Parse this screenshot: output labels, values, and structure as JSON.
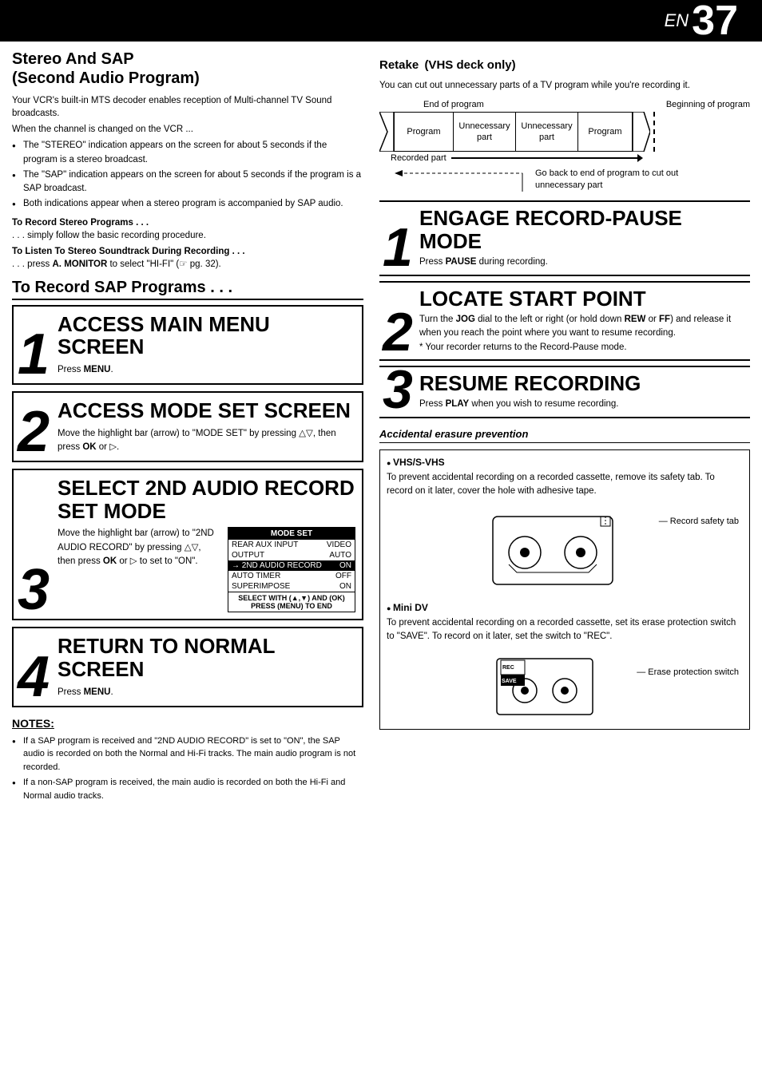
{
  "header": {
    "en_label": "EN",
    "page_number": "37"
  },
  "left": {
    "section1": {
      "title": "Stereo And SAP\n(Second Audio Program)",
      "intro": "Your VCR's built-in MTS decoder enables reception of Multi-channel TV Sound broadcasts.",
      "when_text": "When the channel is changed on the VCR ...",
      "bullets": [
        "The \"STEREO\" indication appears on the screen for about 5 seconds if the program is a stereo broadcast.",
        "The \"SAP\" indication appears on the screen for about 5 seconds if the program is a SAP broadcast.",
        "Both indications appear when a stereo program is accompanied by SAP audio."
      ],
      "sub1_heading": "To Record Stereo Programs . . .",
      "sub1_text": ". . . simply follow the basic recording procedure.",
      "sub2_heading": "To Listen To Stereo Soundtrack During Recording . . .",
      "sub2_text": ". . . press A. MONITOR to select \"HI-FI\" (☞ pg. 32)."
    },
    "sap_section": {
      "title": "To Record SAP Programs . . .",
      "steps": [
        {
          "number": "1",
          "title": "ACCESS MAIN MENU SCREEN",
          "body": "Press MENU."
        },
        {
          "number": "2",
          "title": "ACCESS MODE SET SCREEN",
          "body": "Move the highlight bar (arrow) to \"MODE SET\" by pressing △▽, then press OK or ▷."
        },
        {
          "number": "3",
          "title": "SELECT 2ND AUDIO RECORD SET MODE",
          "body": "Move the highlight bar (arrow) to \"2ND AUDIO RECORD\" by pressing △▽, then press OK or ▷ to set to \"ON\".",
          "mode_set": {
            "header": "MODE SET",
            "rows": [
              {
                "label": "REAR AUX INPUT",
                "value": "VIDEO",
                "highlighted": false
              },
              {
                "label": "OUTPUT",
                "value": "AUTO",
                "highlighted": false
              },
              {
                "label": "→ 2ND AUDIO RECORD",
                "value": "ON",
                "highlighted": true
              },
              {
                "label": "AUTO TIMER",
                "value": "OFF",
                "highlighted": false
              },
              {
                "label": "SUPERIMPOSE",
                "value": "ON",
                "highlighted": false
              }
            ],
            "footer": "SELECT WITH (▲,▼) AND (OK)\nPRESS (MENU) TO END"
          }
        },
        {
          "number": "4",
          "title": "RETURN TO NORMAL SCREEN",
          "body": "Press MENU."
        }
      ]
    },
    "notes": {
      "title": "NOTES:",
      "items": [
        "If a SAP program is received and \"2ND AUDIO RECORD\" is set to \"ON\", the SAP audio is recorded on both the Normal and Hi-Fi tracks. The main audio program is not recorded.",
        "If a non-SAP program is received, the main audio is recorded on both the Hi-Fi and Normal audio tracks."
      ]
    }
  },
  "right": {
    "retake": {
      "title": "Retake",
      "subtitle": "(VHS deck only)",
      "intro": "You can cut out unnecessary parts of a TV program while you're recording it.",
      "diagram": {
        "end_of_program": "End of program",
        "beginning_of_program": "Beginning of program",
        "boxes": [
          "Program",
          "Unnecessary\npart",
          "Unnecessary\npart",
          "Program"
        ],
        "recorded_part": "Recorded part",
        "go_back_text": "Go back to end of program to cut out\nunnecessary part"
      }
    },
    "steps": [
      {
        "number": "1",
        "title": "ENGAGE RECORD-PAUSE MODE",
        "body": "Press PAUSE during recording."
      },
      {
        "number": "2",
        "title": "LOCATE START POINT",
        "body": "Turn the JOG dial to the left or right (or hold down REW or FF) and release it when you reach the point where you want to resume recording.\n* Your recorder returns to the Record-Pause mode."
      },
      {
        "number": "3",
        "title": "RESUME RECORDING",
        "body": "Press PLAY when you wish to resume recording."
      }
    ],
    "accidental_erasure": {
      "title": "Accidental erasure prevention",
      "vhs": {
        "title": "VHS/S-VHS",
        "text": "To prevent accidental recording on a recorded cassette, remove its safety tab. To record on it later, cover the hole with adhesive tape.",
        "label": "Record safety tab"
      },
      "mini_dv": {
        "title": "Mini DV",
        "text": "To prevent accidental recording on a recorded cassette, set its erase protection switch to \"SAVE\". To record on it later, set the switch to \"REC\".",
        "label": "Erase protection\nswitch"
      }
    }
  }
}
